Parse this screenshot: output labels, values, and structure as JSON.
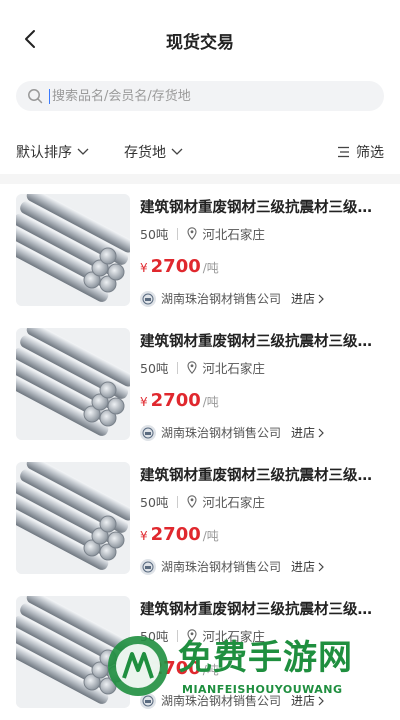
{
  "header": {
    "title": "现货交易"
  },
  "search": {
    "placeholder": "搜索品名/会员名/存货地"
  },
  "filters": {
    "sort_label": "默认排序",
    "location_label": "存货地",
    "filter_label": "筛选"
  },
  "products": [
    {
      "name": "建筑钢材重废钢材三级抗震材三级…",
      "quantity": "50吨",
      "location": "河北石家庄",
      "currency": "¥",
      "price": "2700",
      "unit": "/吨",
      "shop": "湖南珠治钢材销售公司",
      "enter": "进店"
    },
    {
      "name": "建筑钢材重废钢材三级抗震材三级…",
      "quantity": "50吨",
      "location": "河北石家庄",
      "currency": "¥",
      "price": "2700",
      "unit": "/吨",
      "shop": "湖南珠治钢材销售公司",
      "enter": "进店"
    },
    {
      "name": "建筑钢材重废钢材三级抗震材三级…",
      "quantity": "50吨",
      "location": "河北石家庄",
      "currency": "¥",
      "price": "2700",
      "unit": "/吨",
      "shop": "湖南珠治钢材销售公司",
      "enter": "进店"
    },
    {
      "name": "建筑钢材重废钢材三级抗震材三级…",
      "quantity": "50吨",
      "location": "河北石家庄",
      "currency": "¥",
      "price": "2700",
      "unit": "/吨",
      "shop": "湖南珠治钢材销售公司",
      "enter": "进店"
    }
  ],
  "watermark": {
    "text": "免费手游网",
    "subtext": "MIANFEISHOUYOUWANG"
  },
  "colors": {
    "price": "#e0282e",
    "caret": "#3a7afe",
    "watermark": "#1f8f3f"
  },
  "icons": {
    "back": "chevron-left-icon",
    "search": "search-icon",
    "dropdown": "chevron-down-icon",
    "filter": "filter-icon",
    "location": "location-pin-icon",
    "shop": "shop-logo-icon",
    "enter": "chevron-right-icon"
  }
}
